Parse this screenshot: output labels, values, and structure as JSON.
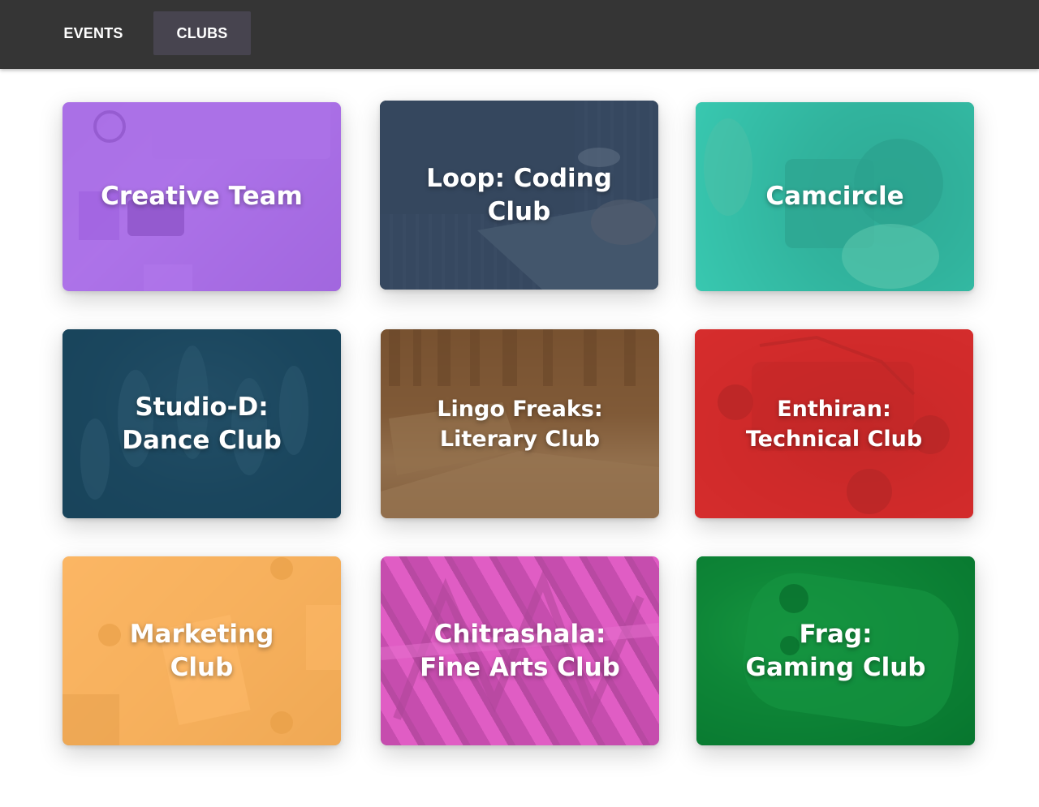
{
  "nav": {
    "events_label": "EVENTS",
    "clubs_label": "CLUBS",
    "active_tab": "CLUBS"
  },
  "clubs": [
    {
      "name_line1": "Creative Team",
      "name_line2": "",
      "image": "laptop-desk-photo",
      "tint": "#a462e7"
    },
    {
      "name_line1": "Loop: Coding",
      "name_line2": "Club",
      "image": "laptop-code-photo",
      "tint": "#3c5069"
    },
    {
      "name_line1": "Camcircle",
      "name_line2": "",
      "image": "camera-photo",
      "tint": "#33c9b0"
    },
    {
      "name_line1": "Studio-D:",
      "name_line2": "Dance Club",
      "image": "dancers-photo",
      "tint": "#1a4860"
    },
    {
      "name_line1": "Lingo Freaks:",
      "name_line2": "Literary Club",
      "image": "open-book-photo",
      "tint": "#7d5532"
    },
    {
      "name_line1": "Enthiran:",
      "name_line2": "Technical Club",
      "image": "robot-car-photo",
      "tint": "#d62c2c"
    },
    {
      "name_line1": "Marketing",
      "name_line2": "Club",
      "image": "meeting-table-photo",
      "tint": "#ffac4a"
    },
    {
      "name_line1": "Chitrashala:",
      "name_line2": "Fine Arts Club",
      "image": "graffiti-photo",
      "tint": "#e05cc4"
    },
    {
      "name_line1": "Frag:",
      "name_line2": "Gaming Club",
      "image": "game-controller-photo",
      "tint": "#087a30"
    }
  ]
}
